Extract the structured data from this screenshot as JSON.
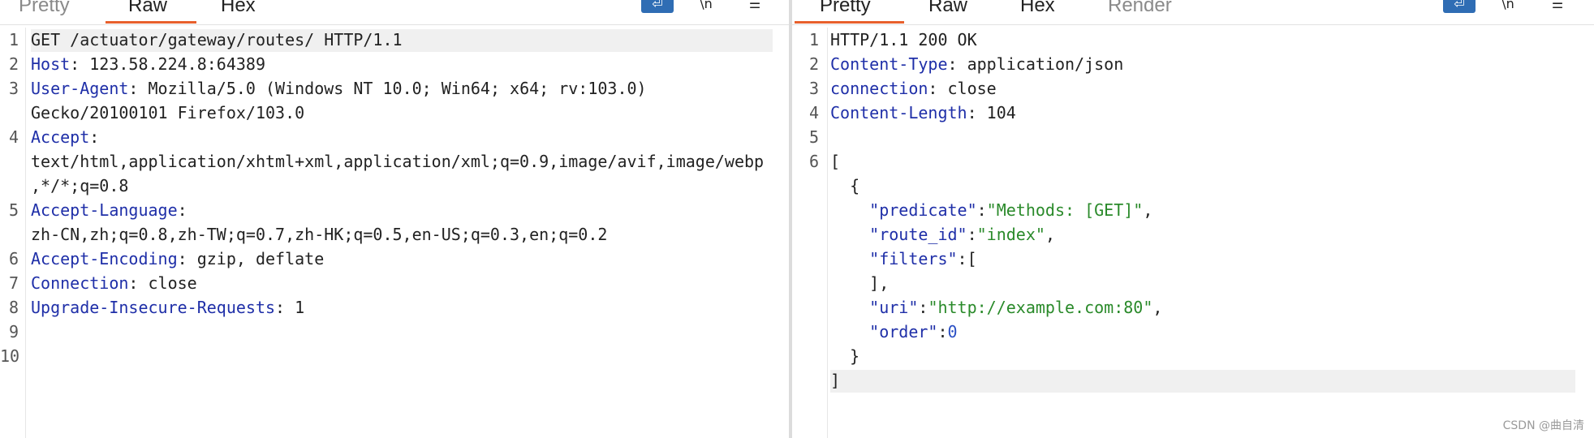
{
  "request": {
    "tabs": [
      "Pretty",
      "Raw",
      "Hex"
    ],
    "active_tab": "Raw",
    "wrap_icon": "wrap-lines-icon",
    "newline_toggle": "\\n",
    "menu_icon": "hamburger-menu-icon",
    "lines": [
      {
        "num": "1",
        "text": "GET /actuator/gateway/routes/ HTTP/1.1",
        "highlight": true
      },
      {
        "num": "2",
        "key": "Host",
        "value": ": 123.58.224.8:64389"
      },
      {
        "num": "3",
        "key": "User-Agent",
        "value": ": Mozilla/5.0 (Windows NT 10.0; Win64; x64; rv:103.0)"
      },
      {
        "num": "",
        "text": "Gecko/20100101 Firefox/103.0"
      },
      {
        "num": "4",
        "key": "Accept",
        "value": ":"
      },
      {
        "num": "",
        "text": "text/html,application/xhtml+xml,application/xml;q=0.9,image/avif,image/webp"
      },
      {
        "num": "",
        "text": ",*/*;q=0.8"
      },
      {
        "num": "5",
        "key": "Accept-Language",
        "value": ":"
      },
      {
        "num": "",
        "text": "zh-CN,zh;q=0.8,zh-TW;q=0.7,zh-HK;q=0.5,en-US;q=0.3,en;q=0.2"
      },
      {
        "num": "6",
        "key": "Accept-Encoding",
        "value": ": gzip, deflate"
      },
      {
        "num": "7",
        "key": "Connection",
        "value": ": close"
      },
      {
        "num": "8",
        "key": "Upgrade-Insecure-Requests",
        "value": ": 1"
      },
      {
        "num": "9",
        "text": ""
      },
      {
        "num": "10",
        "text": ""
      }
    ]
  },
  "response": {
    "tabs": [
      "Pretty",
      "Raw",
      "Hex",
      "Render"
    ],
    "active_tab": "Pretty",
    "wrap_icon": "wrap-lines-icon",
    "newline_toggle": "\\n",
    "menu_icon": "hamburger-menu-icon",
    "lines": [
      {
        "num": "1",
        "text": "HTTP/1.1 200 OK"
      },
      {
        "num": "2",
        "key": "Content-Type",
        "value": ": application/json"
      },
      {
        "num": "3",
        "key": "connection",
        "value": ": close"
      },
      {
        "num": "4",
        "key": "Content-Length",
        "value": ": 104"
      },
      {
        "num": "5",
        "text": ""
      },
      {
        "num": "6",
        "text": "["
      },
      {
        "num": "",
        "text": "  {"
      },
      {
        "num": "",
        "indent": "    ",
        "jkey": "\"predicate\"",
        "sep": ":",
        "jstr": "\"Methods: [GET]\"",
        "tail": ","
      },
      {
        "num": "",
        "indent": "    ",
        "jkey": "\"route_id\"",
        "sep": ":",
        "jstr": "\"index\"",
        "tail": ","
      },
      {
        "num": "",
        "indent": "    ",
        "jkey": "\"filters\"",
        "sep": ":[",
        "jstr": "",
        "tail": ""
      },
      {
        "num": "",
        "text": "    ],"
      },
      {
        "num": "",
        "indent": "    ",
        "jkey": "\"uri\"",
        "sep": ":",
        "jstr": "\"http://example.com:80\"",
        "tail": ","
      },
      {
        "num": "",
        "indent": "    ",
        "jkey": "\"order\"",
        "sep": ":",
        "jnum": "0",
        "tail": ""
      },
      {
        "num": "",
        "text": "  }"
      },
      {
        "num": "",
        "text": "]",
        "highlight": true
      }
    ]
  },
  "watermark": "CSDN @曲自清",
  "colors": {
    "accent_tab": "#e8602c",
    "header_key": "#1f2fa8",
    "json_string": "#2a8a2a",
    "json_number": "#2a4fc4",
    "wrap_button": "#2f6db4"
  }
}
